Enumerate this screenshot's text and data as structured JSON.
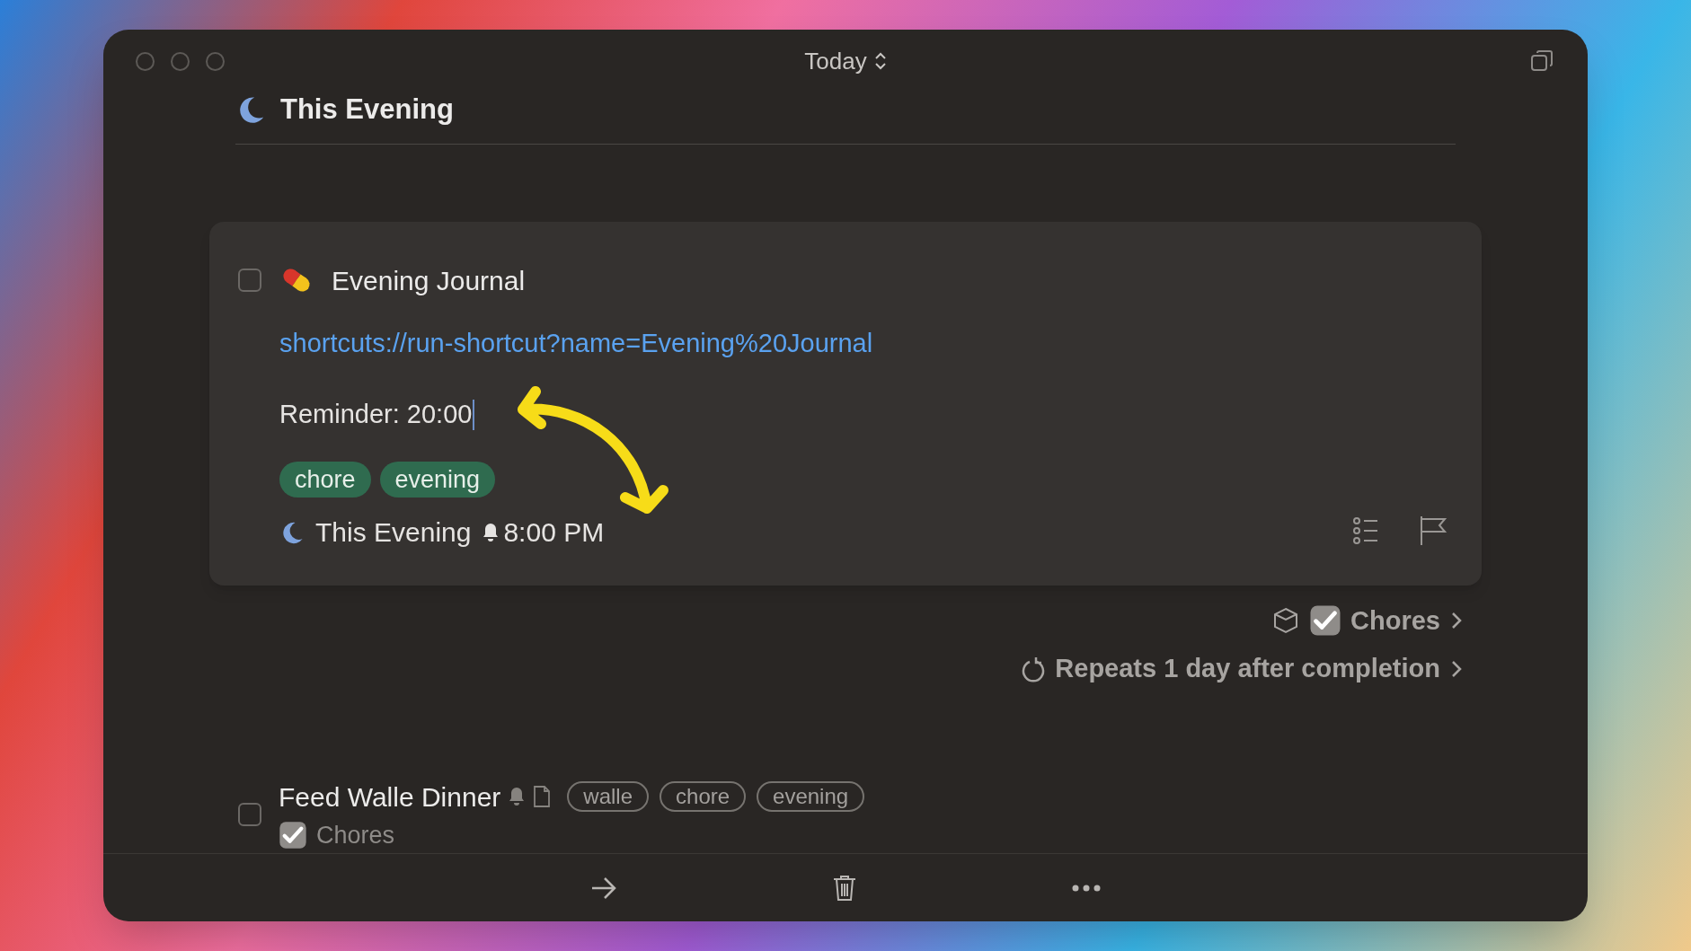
{
  "window": {
    "title": "Today"
  },
  "section": {
    "title": "This Evening"
  },
  "expanded_task": {
    "checked": false,
    "title": "Evening Journal",
    "link": "shortcuts://run-shortcut?name=Evening%20Journal",
    "note": "Reminder: 20:00",
    "tags": [
      "chore",
      "evening"
    ],
    "when": "This Evening",
    "reminder": "8:00 PM",
    "flagged": false
  },
  "task_meta": {
    "list": "Chores",
    "repeat": "Repeats 1 day after completion"
  },
  "tasks": [
    {
      "checked": false,
      "title": "Feed Walle Dinner",
      "has_reminder": true,
      "has_note": true,
      "tags": [
        "walle",
        "chore",
        "evening"
      ],
      "list": "Chores"
    }
  ]
}
